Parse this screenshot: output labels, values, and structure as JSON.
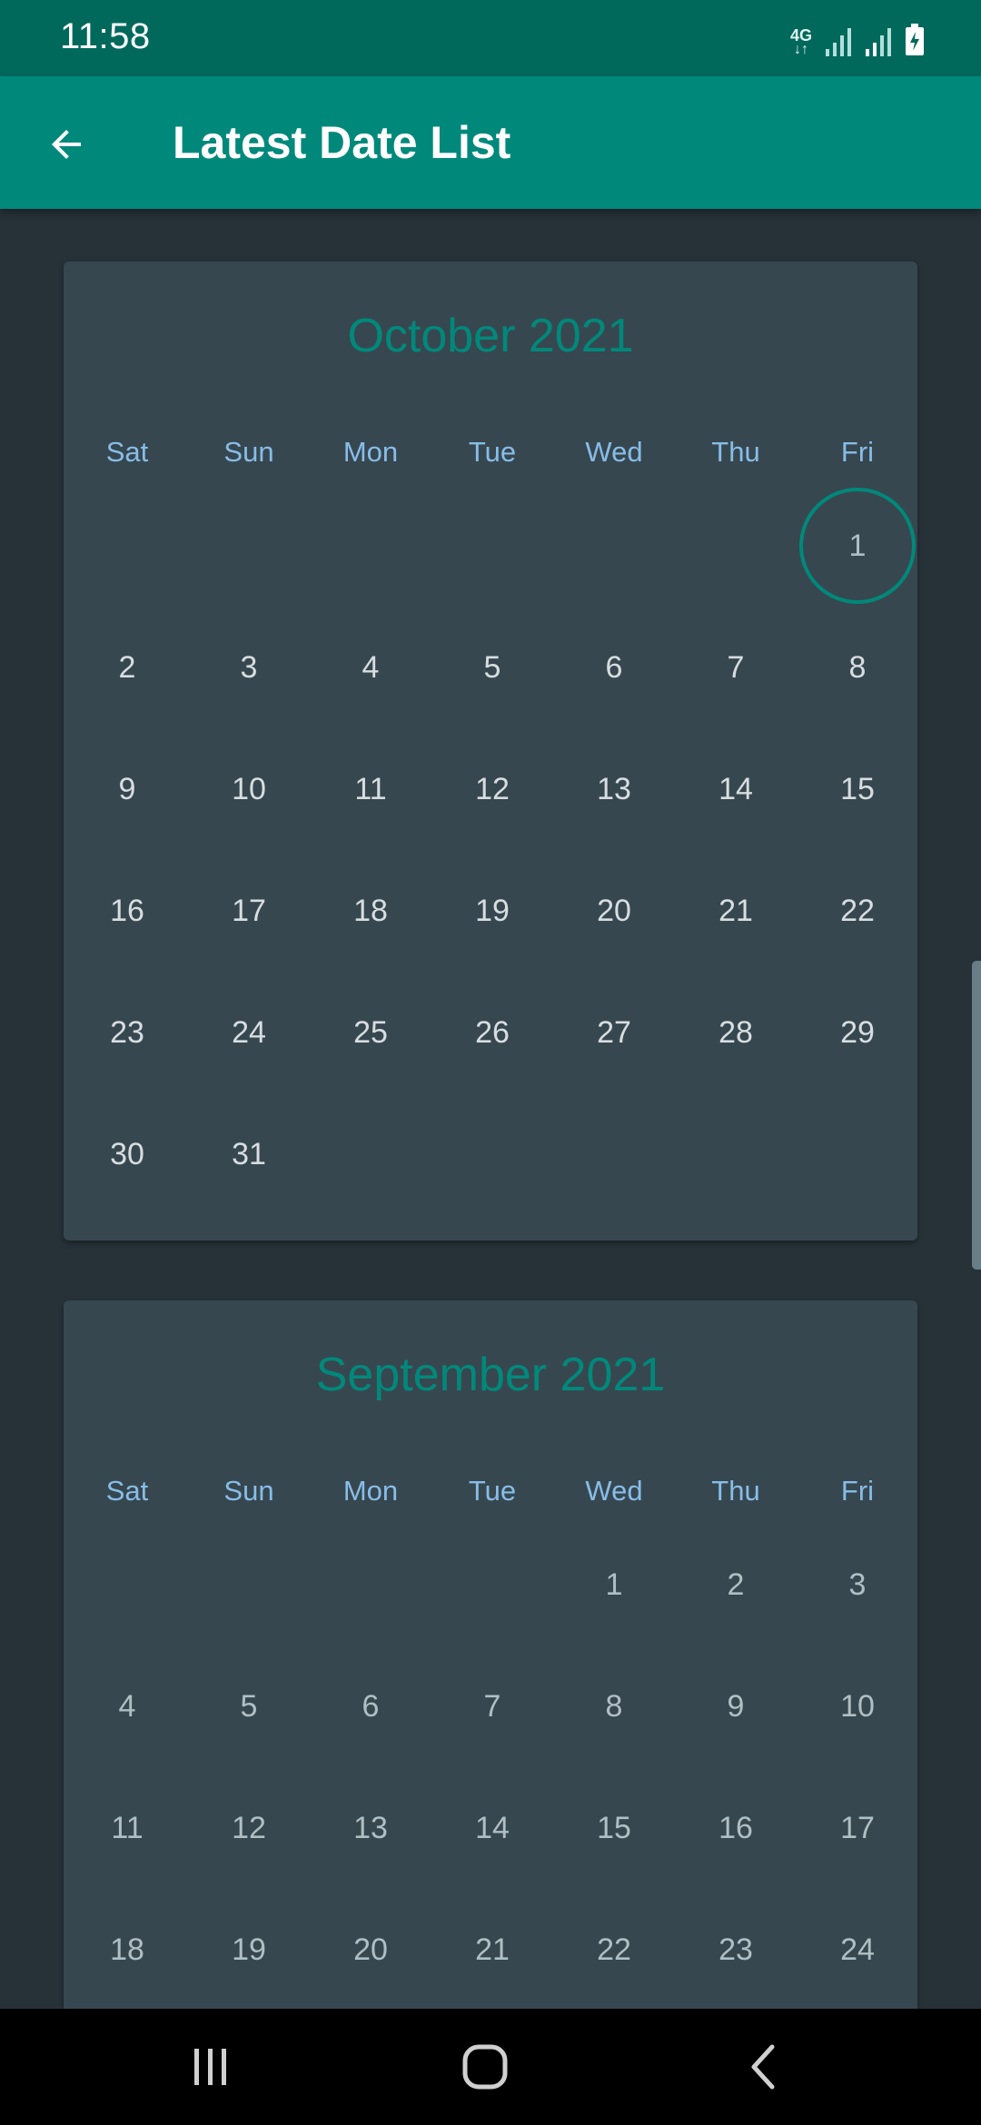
{
  "status_bar": {
    "time": "11:58",
    "network_type": "4G",
    "network_arrows": "↓↑"
  },
  "app_bar": {
    "title": "Latest Date List",
    "back_icon": "arrow-back-icon"
  },
  "colors": {
    "primary": "#00897b",
    "primary_dark": "#00695c",
    "background": "#263238",
    "card": "#37474f",
    "weekday_text": "#90caf9"
  },
  "weekdays": [
    "Sat",
    "Sun",
    "Mon",
    "Tue",
    "Wed",
    "Thu",
    "Fri"
  ],
  "months": [
    {
      "title": "October 2021",
      "rows": [
        [
          "",
          "",
          "",
          "",
          "",
          "",
          "1"
        ],
        [
          "2",
          "3",
          "4",
          "5",
          "6",
          "7",
          "8"
        ],
        [
          "9",
          "10",
          "11",
          "12",
          "13",
          "14",
          "15"
        ],
        [
          "16",
          "17",
          "18",
          "19",
          "20",
          "21",
          "22"
        ],
        [
          "23",
          "24",
          "25",
          "26",
          "27",
          "28",
          "29"
        ],
        [
          "30",
          "31",
          "",
          "",
          "",
          "",
          ""
        ]
      ],
      "selected_day": "1"
    },
    {
      "title": "September 2021",
      "rows": [
        [
          "",
          "",
          "",
          "",
          "1",
          "2",
          "3"
        ],
        [
          "4",
          "5",
          "6",
          "7",
          "8",
          "9",
          "10"
        ],
        [
          "11",
          "12",
          "13",
          "14",
          "15",
          "16",
          "17"
        ],
        [
          "18",
          "19",
          "20",
          "21",
          "22",
          "23",
          "24"
        ]
      ],
      "selected_day": ""
    }
  ],
  "nav_bar": {
    "recent_icon": "recent-apps-icon",
    "home_icon": "home-icon",
    "back_icon": "nav-back-icon"
  }
}
